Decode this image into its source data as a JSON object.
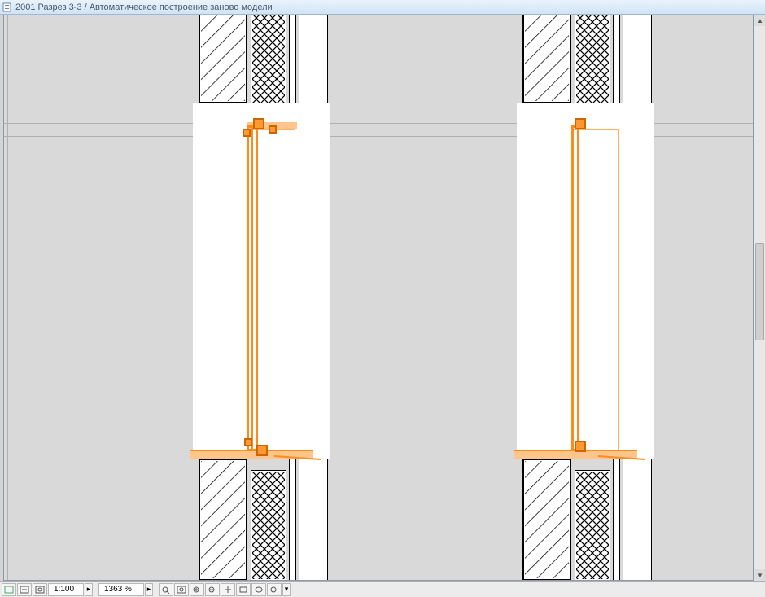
{
  "window": {
    "title": "2001 Разрез 3-3 / Автоматическое построение заново модели"
  },
  "status": {
    "scale": "1:100",
    "zoom": "1363 %"
  },
  "icons": {
    "doc": "doc-icon",
    "arrow_up": "▲",
    "arrow_down": "▼"
  }
}
